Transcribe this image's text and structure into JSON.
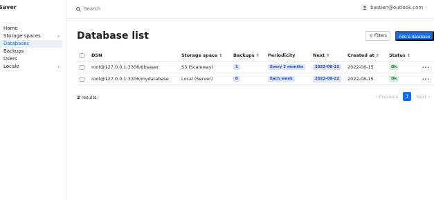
{
  "app": {
    "brand": "Saver"
  },
  "sidebar": {
    "items": [
      {
        "label": "Home",
        "has_submenu": false,
        "active": false
      },
      {
        "label": "Storage spaces",
        "has_submenu": true,
        "active": false
      },
      {
        "label": "Databases",
        "has_submenu": false,
        "active": true
      },
      {
        "label": "Backups",
        "has_submenu": false,
        "active": false
      },
      {
        "label": "Users",
        "has_submenu": false,
        "active": false
      },
      {
        "label": "Locale",
        "has_submenu": true,
        "active": false
      }
    ]
  },
  "topbar": {
    "search_label": "Search",
    "user_email": "bastien@outlook.com"
  },
  "page": {
    "title": "Database list",
    "filters_label": "Filters",
    "add_label": "Add a database"
  },
  "table": {
    "headers": {
      "dsn": "DSN",
      "storage": "Storage space",
      "backups": "Backups",
      "periodicity": "Periodicity",
      "next": "Next",
      "created": "Created at",
      "status": "Status"
    },
    "sort_glyph": "⇕",
    "rows": [
      {
        "dsn": "root@127.0.0.1:3306/dbsaver",
        "storage": "S3 (Scaleway)",
        "backups": "1",
        "periodicity": "Every 2 months",
        "next": "2022-08-22",
        "created": "2022-08-15",
        "status": "Ok",
        "actions": "···"
      },
      {
        "dsn": "root@127.0.0.1:3306/mydatabase",
        "storage": "Local (Server)",
        "backups": "0",
        "periodicity": "Each week",
        "next": "2022-08-22",
        "created": "2022-08-15",
        "status": "Ok",
        "actions": "···"
      }
    ]
  },
  "footer": {
    "results_count": "2",
    "results_label": "results"
  },
  "pagination": {
    "previous": "‹ Previous",
    "current": "1",
    "next": "Next ›"
  },
  "colors": {
    "accent": "#0d6efd",
    "badge_blue_bg": "#dbe4ff",
    "badge_green_bg": "#d3f3dc"
  },
  "icons": {
    "search": "search-icon",
    "user": "user-icon",
    "filter": "filter-icon",
    "chevron": "chevron-right-icon"
  }
}
